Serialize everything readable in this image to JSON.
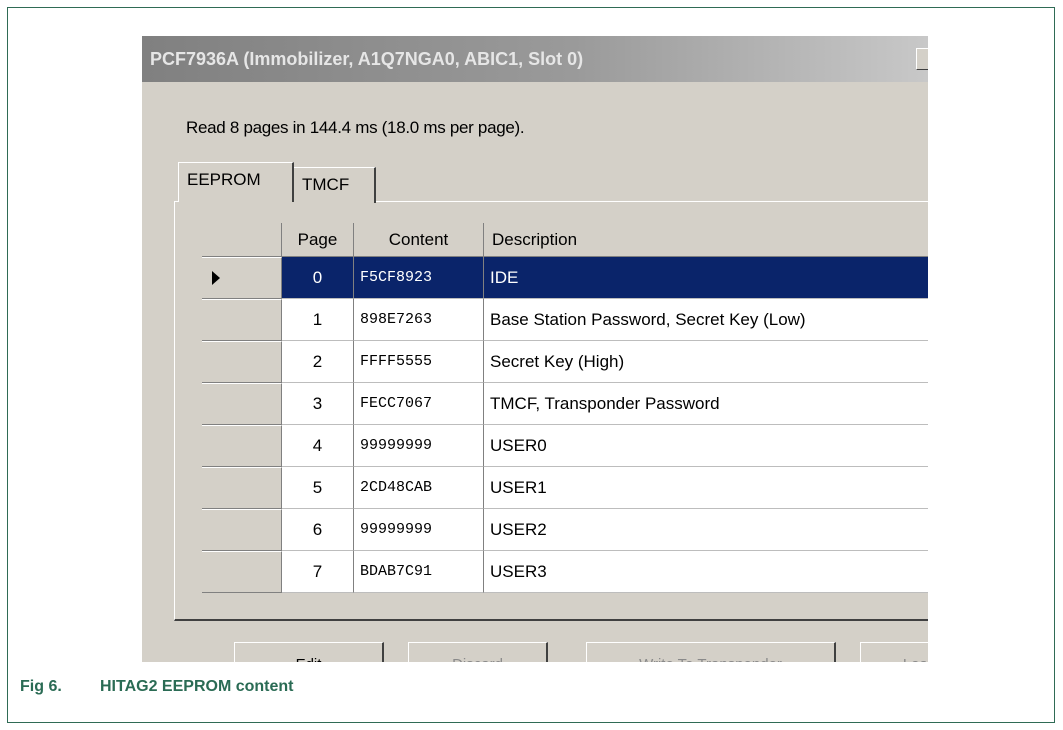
{
  "window": {
    "title": "PCF7936A (Immobilizer, A1Q7NGA0, ABIC1, Slot 0)"
  },
  "status_text": "Read 8 pages in 144.4 ms (18.0 ms per page).",
  "tabs": [
    {
      "label": "EEPROM",
      "active": true
    },
    {
      "label": "TMCF",
      "active": false
    }
  ],
  "table": {
    "columns": [
      "Page",
      "Content",
      "Description"
    ],
    "selected_row": 0,
    "rows": [
      {
        "page": "0",
        "content": "F5CF8923",
        "description": "IDE"
      },
      {
        "page": "1",
        "content": "898E7263",
        "description": "Base Station Password, Secret Key (Low)"
      },
      {
        "page": "2",
        "content": "FFFF5555",
        "description": "Secret Key (High)"
      },
      {
        "page": "3",
        "content": "FECC7067",
        "description": "TMCF, Transponder Password"
      },
      {
        "page": "4",
        "content": "99999999",
        "description": "USER0"
      },
      {
        "page": "5",
        "content": "2CD48CAB",
        "description": "USER1"
      },
      {
        "page": "6",
        "content": "99999999",
        "description": "USER2"
      },
      {
        "page": "7",
        "content": "BDAB7C91",
        "description": "USER3"
      }
    ]
  },
  "buttons": [
    {
      "label": "Edit",
      "enabled": true
    },
    {
      "label": "Discard",
      "enabled": false
    },
    {
      "label": "Write To Transponder",
      "enabled": false
    },
    {
      "label": "Load",
      "enabled": false
    }
  ],
  "caption": {
    "number": "Fig 6.",
    "text": "HITAG2 EEPROM content"
  },
  "colors": {
    "selection": "#0a246a",
    "caption": "#2a6b54",
    "frame_border": "#2f6b55"
  }
}
